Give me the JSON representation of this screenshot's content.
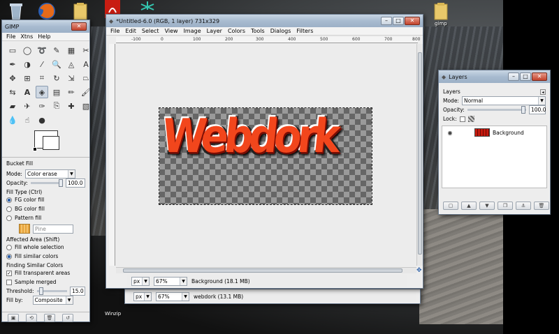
{
  "desktop": {
    "icons": [
      {
        "name": "recycle-bin",
        "label": ""
      },
      {
        "name": "firefox",
        "label": ""
      },
      {
        "name": "folder",
        "label": ""
      },
      {
        "name": "adobe-reader",
        "label": ""
      },
      {
        "name": "gimp-folder",
        "label": "gimp"
      }
    ],
    "bottom_label": "Winzip"
  },
  "toolbox": {
    "title": "GIMP",
    "menu": [
      "File",
      "Xtns",
      "Help"
    ],
    "tool_options_title": "Bucket Fill",
    "mode_label": "Mode:",
    "mode_value": "Color erase",
    "opacity_label": "Opacity:",
    "opacity_value": "100.0",
    "fill_type_label": "Fill Type  (Ctrl)",
    "fill_types": [
      "FG color fill",
      "BG color fill",
      "Pattern fill"
    ],
    "fill_type_selected": 0,
    "pattern_name": "Pine",
    "affected_label": "Affected Area  (Shift)",
    "affected_options": [
      "Fill whole selection",
      "Fill similar colors"
    ],
    "affected_selected": 1,
    "finding_label": "Finding Similar Colors",
    "fill_transparent_label": "Fill transparent areas",
    "fill_transparent_checked": true,
    "sample_merged_label": "Sample merged",
    "sample_merged_checked": false,
    "threshold_label": "Threshold:",
    "threshold_value": "15.0",
    "fill_by_label": "Fill by:",
    "fill_by_value": "Composite"
  },
  "image_window": {
    "title": "*Untitled-6.0 (RGB, 1 layer) 731x329",
    "menu": [
      "File",
      "Edit",
      "Select",
      "View",
      "Image",
      "Layer",
      "Colors",
      "Tools",
      "Dialogs",
      "Filters"
    ],
    "ruler_ticks": [
      "-100",
      "0",
      "100",
      "200",
      "300",
      "400",
      "500",
      "600",
      "700",
      "800"
    ],
    "artwork_text": "Webdork",
    "status": {
      "unit": "px",
      "zoom": "67%",
      "info": "Background (18.1 MB)"
    }
  },
  "second_window_status": {
    "unit": "px",
    "zoom": "67%",
    "info": "webdork (13.1 MB)"
  },
  "layers_window": {
    "title": "Layers",
    "tab_label": "Layers",
    "mode_label": "Mode:",
    "mode_value": "Normal",
    "opacity_label": "Opacity:",
    "opacity_value": "100.0",
    "lock_label": "Lock:",
    "layers": [
      {
        "name": "Background",
        "visible": true
      }
    ]
  },
  "colors": {
    "titlebar": "#a8bbd0",
    "accent": "#f2461c",
    "window_bg": "#ededed"
  }
}
